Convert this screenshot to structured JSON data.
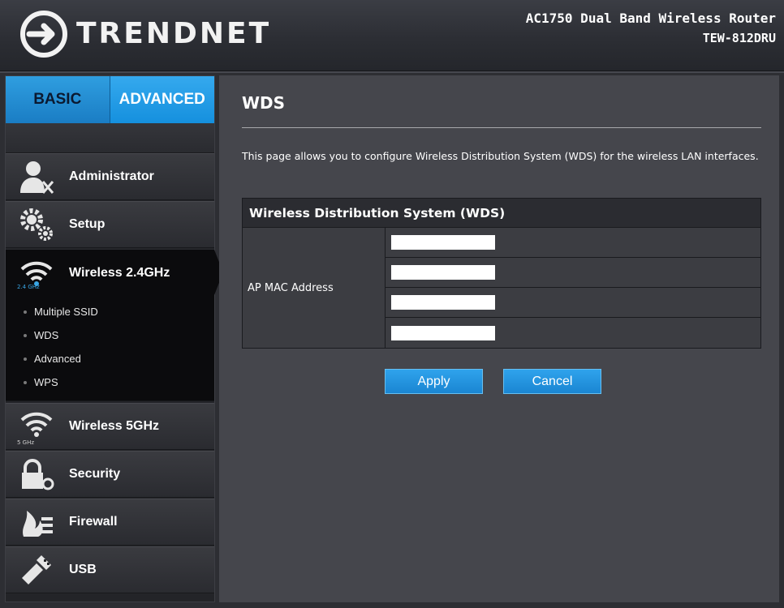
{
  "header": {
    "brand": "TRENDNET",
    "product_line1": "AC1750 Dual Band Wireless Router",
    "product_line2": "TEW-812DRU"
  },
  "tabs": [
    {
      "label": "BASIC",
      "active": false
    },
    {
      "label": "ADVANCED",
      "active": true
    }
  ],
  "menu": {
    "administrator": {
      "label": "Administrator",
      "icon": "administrator-icon"
    },
    "setup": {
      "label": "Setup",
      "icon": "gears-icon"
    },
    "wireless24": {
      "label": "Wireless 2.4GHz",
      "icon": "wifi-icon",
      "icon_caption": "2.4 GHz"
    },
    "wireless24_sub": [
      "Multiple SSID",
      "WDS",
      "Advanced",
      "WPS"
    ],
    "wireless5": {
      "label": "Wireless 5GHz",
      "icon": "wifi-icon",
      "icon_caption": "5 GHz"
    },
    "security": {
      "label": "Security",
      "icon": "padlock-key-icon"
    },
    "firewall": {
      "label": "Firewall",
      "icon": "firewall-icon"
    },
    "usb": {
      "label": "USB",
      "icon": "usb-icon"
    }
  },
  "page": {
    "title": "WDS",
    "description": "This page allows you to configure Wireless Distribution System (WDS) for the wireless LAN interfaces.",
    "table_title": "Wireless Distribution System (WDS)",
    "ap_mac_label": "AP MAC Address",
    "mac_values": [
      "",
      "",
      "",
      ""
    ]
  },
  "buttons": {
    "apply": "Apply",
    "cancel": "Cancel"
  },
  "colors": {
    "accent_blue": "#1590de",
    "panel_bg": "#45464c",
    "sidebar_bg": "#232428"
  }
}
